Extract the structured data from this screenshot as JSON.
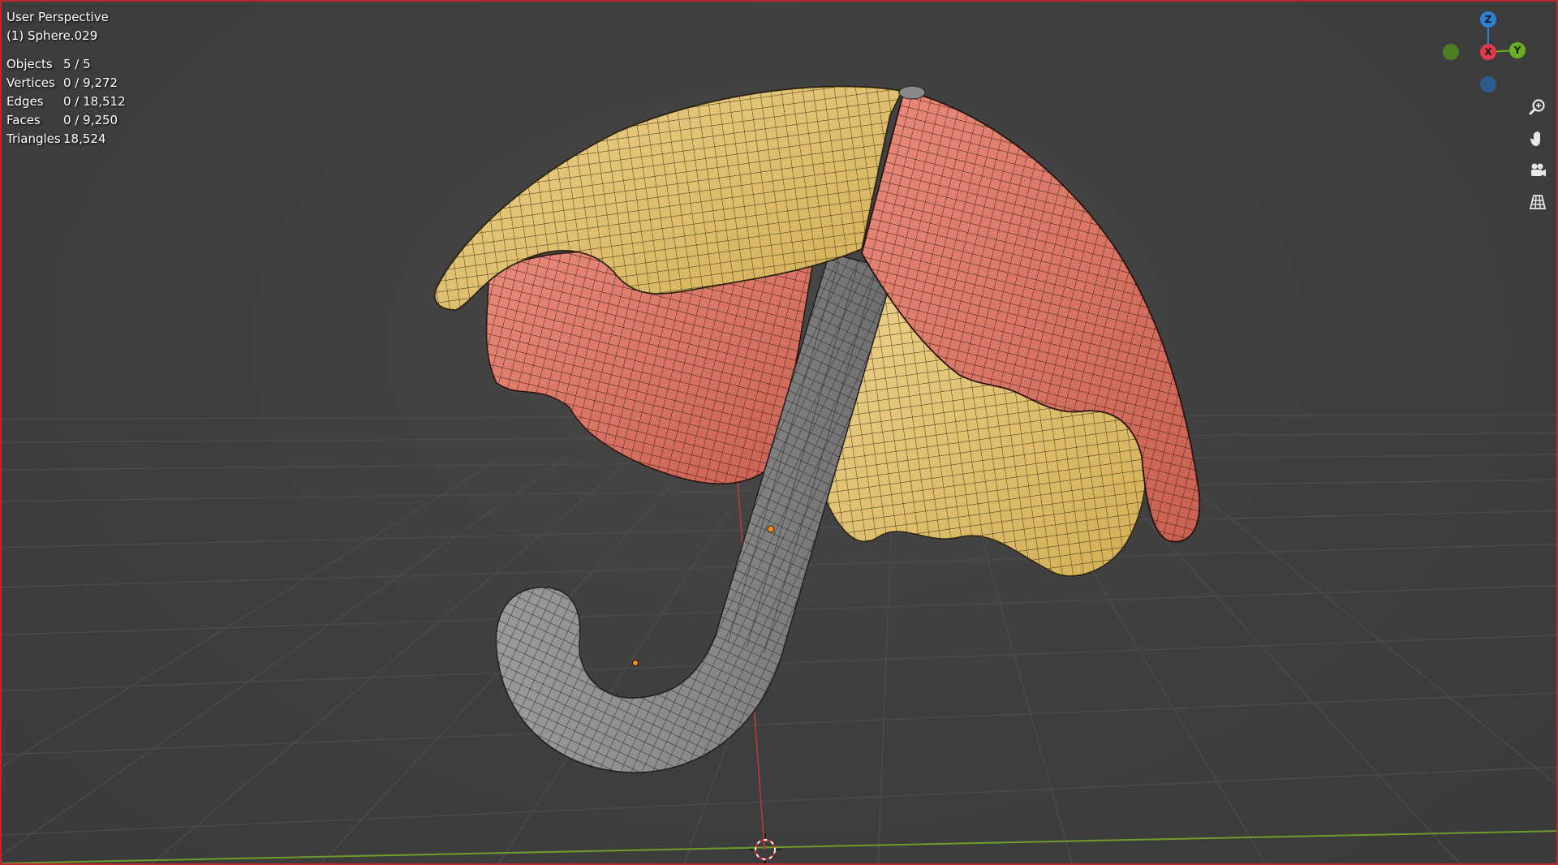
{
  "viewport": {
    "view_name": "User Perspective",
    "active_object": "(1) Sphere.029",
    "border_color": "#b8282c",
    "background_color": "#3d3d3d"
  },
  "stats": [
    {
      "label": "Objects",
      "value": "5 / 5"
    },
    {
      "label": "Vertices",
      "value": "0 / 9,272"
    },
    {
      "label": "Edges",
      "value": "0 / 18,512"
    },
    {
      "label": "Faces",
      "value": "0 / 9,250"
    },
    {
      "label": "Triangles",
      "value": "18,524"
    }
  ],
  "gizmo": {
    "z_label": "Z",
    "x_label": "X",
    "y_label": "Y",
    "z_color": "#2f7fd1",
    "x_color": "#e0384f",
    "y_color": "#6aae23",
    "neg_y_color": "#4e8a1c",
    "neg_z_color": "#2b5f9a"
  },
  "nav_buttons": [
    {
      "icon": "zoom-icon"
    },
    {
      "icon": "hand-pan-icon"
    },
    {
      "icon": "camera-icon"
    },
    {
      "icon": "grid-ortho-icon"
    }
  ],
  "model": {
    "canopy_yellow": "#e0c16a",
    "canopy_red": "#d97565",
    "handle_gray": "#8c8c8c",
    "grid_color": "#4a4a4a",
    "x_axis_line_color": "#6f9b2a",
    "z_axis_line_color": "#c0383a"
  }
}
